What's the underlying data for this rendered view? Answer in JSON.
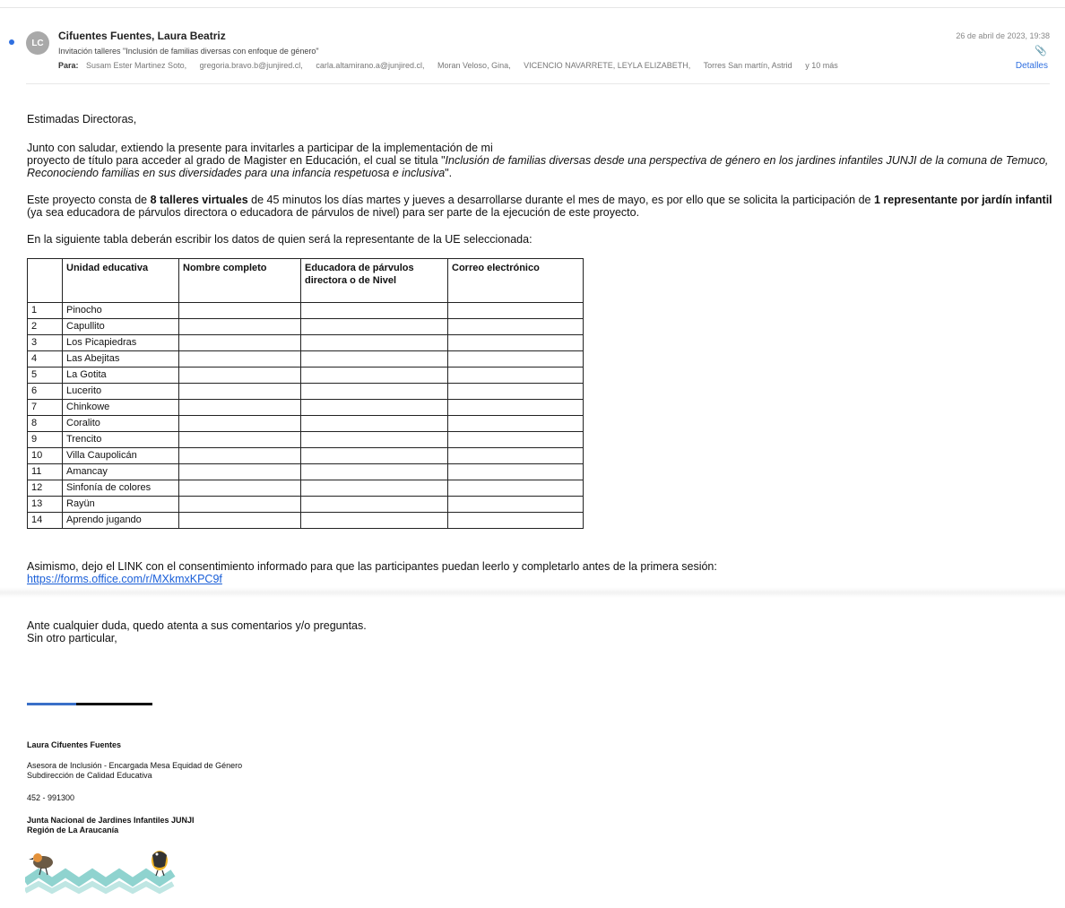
{
  "header": {
    "avatar_initials": "LC",
    "sender": "Cifuentes Fuentes, Laura Beatriz",
    "subject": "Invitación talleres \"Inclusión de familias diversas con enfoque de género\"",
    "to_label": "Para:",
    "recipients": [
      "Susam Ester Martinez Soto,",
      "gregoria.bravo.b@junjired.cl,",
      "carla.altamirano.a@junjired.cl,",
      "Moran Veloso, Gina,",
      "VICENCIO NAVARRETE, LEYLA ELIZABETH,",
      "Torres San martín, Astrid",
      "y 10 más"
    ],
    "date": "26 de abril de 2023, 19:38",
    "details_label": "Detalles"
  },
  "body": {
    "greeting": "Estimadas Directoras,",
    "p1_a": "Junto con saludar, extiendo la presente para invitarles a participar de la implementación de mi",
    "p1_b": "proyecto de título para acceder al grado de Magister en Educación, el cual se titula \"",
    "p1_title": "Inclusión de familias diversas desde una perspectiva de género en los jardines infantiles JUNJI de la comuna de Temuco, Reconociendo familias en sus diversidades para una infancia respetuosa e inclusiva",
    "p1_end": "\".",
    "p2_a": "Este proyecto consta de ",
    "p2_bold1": "8 talleres virtuales",
    "p2_b": " de 45 minutos los días martes y jueves a desarrollarse durante el mes de mayo, es por ello que se solicita la participación de ",
    "p2_bold2": "1 representante por jardín infantil",
    "p2_c": " (ya sea educadora de párvulos directora o educadora de párvulos de nivel) para ser parte de la ejecución de este proyecto.",
    "p3": "En la siguiente tabla deberán escribir los datos de quien será la representante de la UE seleccionada:",
    "p4": "Asimismo, dejo el LINK con el consentimiento informado para que las participantes puedan leerlo y completarlo antes de la primera sesión:",
    "link": "https://forms.office.com/r/MXkmxKPC9f",
    "p5_a": "Ante cualquier duda, quedo atenta a sus comentarios y/o preguntas.",
    "p5_b": "Sin otro particular,"
  },
  "table": {
    "headers": [
      "",
      "Unidad educativa",
      "Nombre completo",
      "Educadora de párvulos directora o de Nivel",
      "Correo electrónico"
    ],
    "rows": [
      [
        "1",
        "Pinocho"
      ],
      [
        "2",
        "Capullito"
      ],
      [
        "3",
        "Los Picapiedras"
      ],
      [
        "4",
        "Las Abejitas"
      ],
      [
        "5",
        "La Gotita"
      ],
      [
        "6",
        "Lucerito"
      ],
      [
        "7",
        "Chinkowe"
      ],
      [
        "8",
        "Coralito"
      ],
      [
        "9",
        "Trencito"
      ],
      [
        "10",
        "Villa Caupolicán"
      ],
      [
        "11",
        "Amancay"
      ],
      [
        "12",
        "Sinfonía de colores"
      ],
      [
        "13",
        "Rayün"
      ],
      [
        "14",
        "Aprendo jugando"
      ]
    ]
  },
  "signature": {
    "name": "Laura Cifuentes Fuentes",
    "role_1": "Asesora de Inclusión - Encargada Mesa Equidad de Género",
    "role_2": "Subdirección de Calidad Educativa",
    "phone": "452 - 991300",
    "org_1": "Junta Nacional de Jardines Infantiles JUNJI",
    "org_2": "Región de La Araucanía"
  },
  "colors": {
    "accent": "#2f6fe0",
    "link": "#1a5fd8",
    "logo_wave": "#8fd3cf"
  },
  "icons": {
    "attachment": "paperclip-icon",
    "unread": "unread-dot-icon"
  }
}
